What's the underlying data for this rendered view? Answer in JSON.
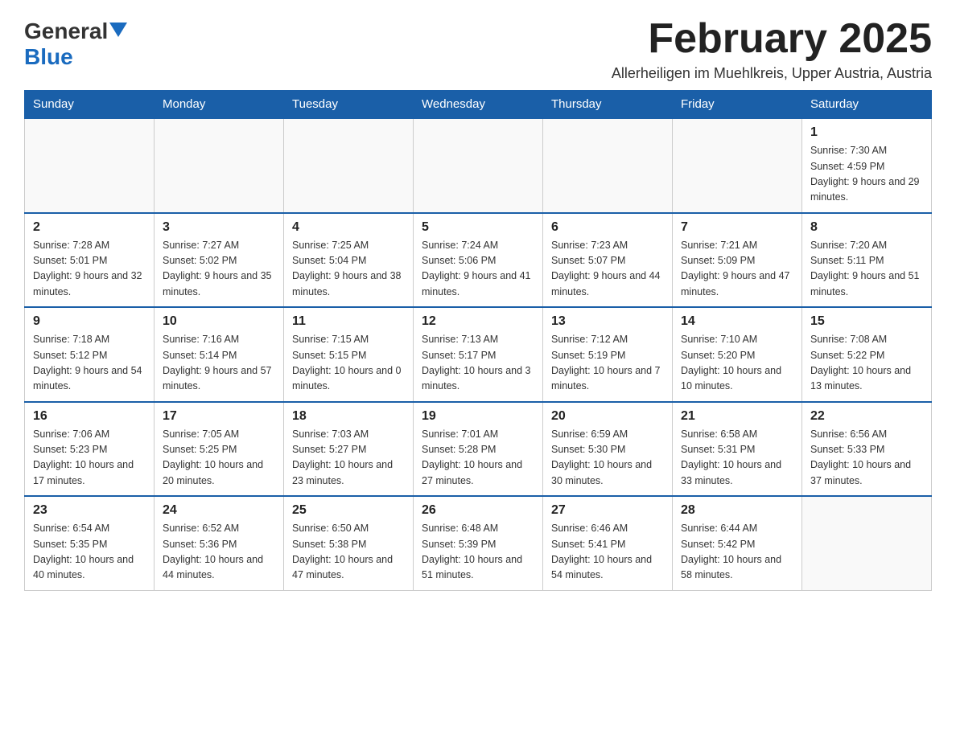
{
  "header": {
    "logo_general": "General",
    "logo_blue": "Blue",
    "month_title": "February 2025",
    "subtitle": "Allerheiligen im Muehlkreis, Upper Austria, Austria"
  },
  "weekdays": [
    "Sunday",
    "Monday",
    "Tuesday",
    "Wednesday",
    "Thursday",
    "Friday",
    "Saturday"
  ],
  "weeks": [
    [
      {
        "day": "",
        "sunrise": "",
        "sunset": "",
        "daylight": ""
      },
      {
        "day": "",
        "sunrise": "",
        "sunset": "",
        "daylight": ""
      },
      {
        "day": "",
        "sunrise": "",
        "sunset": "",
        "daylight": ""
      },
      {
        "day": "",
        "sunrise": "",
        "sunset": "",
        "daylight": ""
      },
      {
        "day": "",
        "sunrise": "",
        "sunset": "",
        "daylight": ""
      },
      {
        "day": "",
        "sunrise": "",
        "sunset": "",
        "daylight": ""
      },
      {
        "day": "1",
        "sunrise": "Sunrise: 7:30 AM",
        "sunset": "Sunset: 4:59 PM",
        "daylight": "Daylight: 9 hours and 29 minutes."
      }
    ],
    [
      {
        "day": "2",
        "sunrise": "Sunrise: 7:28 AM",
        "sunset": "Sunset: 5:01 PM",
        "daylight": "Daylight: 9 hours and 32 minutes."
      },
      {
        "day": "3",
        "sunrise": "Sunrise: 7:27 AM",
        "sunset": "Sunset: 5:02 PM",
        "daylight": "Daylight: 9 hours and 35 minutes."
      },
      {
        "day": "4",
        "sunrise": "Sunrise: 7:25 AM",
        "sunset": "Sunset: 5:04 PM",
        "daylight": "Daylight: 9 hours and 38 minutes."
      },
      {
        "day": "5",
        "sunrise": "Sunrise: 7:24 AM",
        "sunset": "Sunset: 5:06 PM",
        "daylight": "Daylight: 9 hours and 41 minutes."
      },
      {
        "day": "6",
        "sunrise": "Sunrise: 7:23 AM",
        "sunset": "Sunset: 5:07 PM",
        "daylight": "Daylight: 9 hours and 44 minutes."
      },
      {
        "day": "7",
        "sunrise": "Sunrise: 7:21 AM",
        "sunset": "Sunset: 5:09 PM",
        "daylight": "Daylight: 9 hours and 47 minutes."
      },
      {
        "day": "8",
        "sunrise": "Sunrise: 7:20 AM",
        "sunset": "Sunset: 5:11 PM",
        "daylight": "Daylight: 9 hours and 51 minutes."
      }
    ],
    [
      {
        "day": "9",
        "sunrise": "Sunrise: 7:18 AM",
        "sunset": "Sunset: 5:12 PM",
        "daylight": "Daylight: 9 hours and 54 minutes."
      },
      {
        "day": "10",
        "sunrise": "Sunrise: 7:16 AM",
        "sunset": "Sunset: 5:14 PM",
        "daylight": "Daylight: 9 hours and 57 minutes."
      },
      {
        "day": "11",
        "sunrise": "Sunrise: 7:15 AM",
        "sunset": "Sunset: 5:15 PM",
        "daylight": "Daylight: 10 hours and 0 minutes."
      },
      {
        "day": "12",
        "sunrise": "Sunrise: 7:13 AM",
        "sunset": "Sunset: 5:17 PM",
        "daylight": "Daylight: 10 hours and 3 minutes."
      },
      {
        "day": "13",
        "sunrise": "Sunrise: 7:12 AM",
        "sunset": "Sunset: 5:19 PM",
        "daylight": "Daylight: 10 hours and 7 minutes."
      },
      {
        "day": "14",
        "sunrise": "Sunrise: 7:10 AM",
        "sunset": "Sunset: 5:20 PM",
        "daylight": "Daylight: 10 hours and 10 minutes."
      },
      {
        "day": "15",
        "sunrise": "Sunrise: 7:08 AM",
        "sunset": "Sunset: 5:22 PM",
        "daylight": "Daylight: 10 hours and 13 minutes."
      }
    ],
    [
      {
        "day": "16",
        "sunrise": "Sunrise: 7:06 AM",
        "sunset": "Sunset: 5:23 PM",
        "daylight": "Daylight: 10 hours and 17 minutes."
      },
      {
        "day": "17",
        "sunrise": "Sunrise: 7:05 AM",
        "sunset": "Sunset: 5:25 PM",
        "daylight": "Daylight: 10 hours and 20 minutes."
      },
      {
        "day": "18",
        "sunrise": "Sunrise: 7:03 AM",
        "sunset": "Sunset: 5:27 PM",
        "daylight": "Daylight: 10 hours and 23 minutes."
      },
      {
        "day": "19",
        "sunrise": "Sunrise: 7:01 AM",
        "sunset": "Sunset: 5:28 PM",
        "daylight": "Daylight: 10 hours and 27 minutes."
      },
      {
        "day": "20",
        "sunrise": "Sunrise: 6:59 AM",
        "sunset": "Sunset: 5:30 PM",
        "daylight": "Daylight: 10 hours and 30 minutes."
      },
      {
        "day": "21",
        "sunrise": "Sunrise: 6:58 AM",
        "sunset": "Sunset: 5:31 PM",
        "daylight": "Daylight: 10 hours and 33 minutes."
      },
      {
        "day": "22",
        "sunrise": "Sunrise: 6:56 AM",
        "sunset": "Sunset: 5:33 PM",
        "daylight": "Daylight: 10 hours and 37 minutes."
      }
    ],
    [
      {
        "day": "23",
        "sunrise": "Sunrise: 6:54 AM",
        "sunset": "Sunset: 5:35 PM",
        "daylight": "Daylight: 10 hours and 40 minutes."
      },
      {
        "day": "24",
        "sunrise": "Sunrise: 6:52 AM",
        "sunset": "Sunset: 5:36 PM",
        "daylight": "Daylight: 10 hours and 44 minutes."
      },
      {
        "day": "25",
        "sunrise": "Sunrise: 6:50 AM",
        "sunset": "Sunset: 5:38 PM",
        "daylight": "Daylight: 10 hours and 47 minutes."
      },
      {
        "day": "26",
        "sunrise": "Sunrise: 6:48 AM",
        "sunset": "Sunset: 5:39 PM",
        "daylight": "Daylight: 10 hours and 51 minutes."
      },
      {
        "day": "27",
        "sunrise": "Sunrise: 6:46 AM",
        "sunset": "Sunset: 5:41 PM",
        "daylight": "Daylight: 10 hours and 54 minutes."
      },
      {
        "day": "28",
        "sunrise": "Sunrise: 6:44 AM",
        "sunset": "Sunset: 5:42 PM",
        "daylight": "Daylight: 10 hours and 58 minutes."
      },
      {
        "day": "",
        "sunrise": "",
        "sunset": "",
        "daylight": ""
      }
    ]
  ]
}
